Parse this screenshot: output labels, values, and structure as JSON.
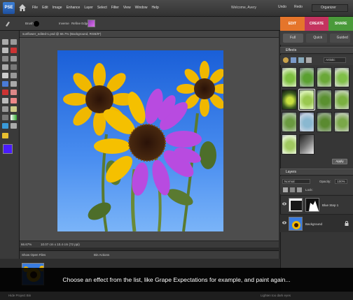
{
  "menubar": {
    "logo_text": "PSE",
    "items": [
      "File",
      "Edit",
      "Image",
      "Enhance",
      "Layer",
      "Select",
      "Filter",
      "View",
      "Window",
      "Help"
    ],
    "welcome": "Welcome, Avery",
    "undo": "Undo",
    "redo": "Redo",
    "organizer": "Organizer"
  },
  "options_bar": {
    "brush_label": "Brush:",
    "invert_label": "Inverse",
    "refine_label": "Refine Edge..."
  },
  "mode_tabs": [
    {
      "label": "EDIT",
      "color": "#e5752b"
    },
    {
      "label": "CREATE",
      "color": "#c4335f"
    },
    {
      "label": "SHARE",
      "color": "#4a9a3a"
    }
  ],
  "edit_subtabs": [
    "Full",
    "Quick",
    "Guided"
  ],
  "document": {
    "title": "sunflower_edited-1.psd @ 66.7% (Background, RGB/8*)",
    "zoom": "66.67%",
    "dimensions": "10.07 cm x 10.4 cm (72 ppi)"
  },
  "project_bin": {
    "dropdown": "Show Open Files",
    "actions": "Bin Actions"
  },
  "effects_panel": {
    "title": "Effects",
    "category": "Artistic",
    "apply_label": "Apply",
    "thumb_count": 14
  },
  "layers_panel": {
    "title": "Layers",
    "blend_mode": "Normal",
    "opacity_label": "Opacity:",
    "opacity_value": "100%",
    "lock_label": "Lock:",
    "layers": [
      {
        "name": "Blue Step 1",
        "selected": false
      },
      {
        "name": "Background",
        "selected": true
      }
    ]
  },
  "caption": "Choose an effect from the list, like Grape Expectations for example, and paint again...",
  "bottom_bar": {
    "left": "Hide Project Bin",
    "right": "Lighten too dark eyes"
  },
  "colors": {
    "foreground": "#4a1cff",
    "background": "#ffffff",
    "petal_purple": "#b84be0"
  }
}
